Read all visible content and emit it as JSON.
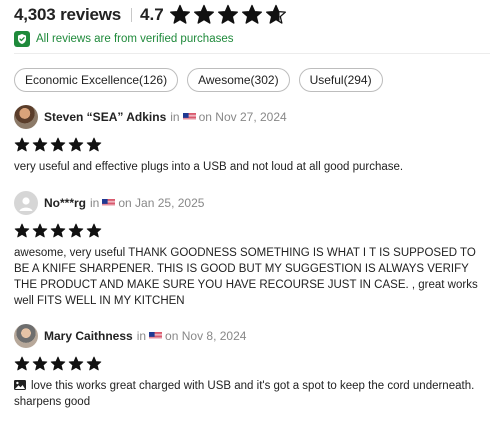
{
  "summary": {
    "review_count": "4,303 reviews",
    "rating": "4.7",
    "rating_value": 4.7,
    "verified_text": "All reviews are from verified purchases"
  },
  "tags": [
    {
      "label": "Economic Excellence(126)"
    },
    {
      "label": "Awesome(302)"
    },
    {
      "label": "Useful(294)"
    }
  ],
  "reviews": [
    {
      "name": "Steven “SEA” Adkins",
      "in": "in",
      "date": "on Nov 27, 2024",
      "stars": 5,
      "text": "very useful and effective plugs into a USB and not loud at all good purchase."
    },
    {
      "name": "No***rg",
      "in": "in",
      "date": "on Jan 25, 2025",
      "stars": 5,
      "text": "awesome, very useful THANK GOODNESS SOMETHING IS WHAT I T IS SUPPOSED TO BE A KNIFE SHARPENER. THIS IS GOOD BUT MY SUGGESTION IS ALWAYS VERIFY THE PRODUCT AND MAKE SURE YOU HAVE RECOURSE JUST IN CASE. , great works well FITS WELL IN MY KITCHEN"
    },
    {
      "name": "Mary Caithness",
      "in": "in",
      "date": "on Nov 8, 2024",
      "stars": 5,
      "text": "love this works great charged with USB and it's got a spot to keep the cord underneath. sharpens good"
    }
  ],
  "colors": {
    "verified_green": "#1f8a3b",
    "star": "#111111",
    "muted": "#888888"
  },
  "icons": {
    "shield": "shield-check-icon",
    "flag": "us-flag-icon",
    "image": "image-icon",
    "star": "star-icon"
  }
}
